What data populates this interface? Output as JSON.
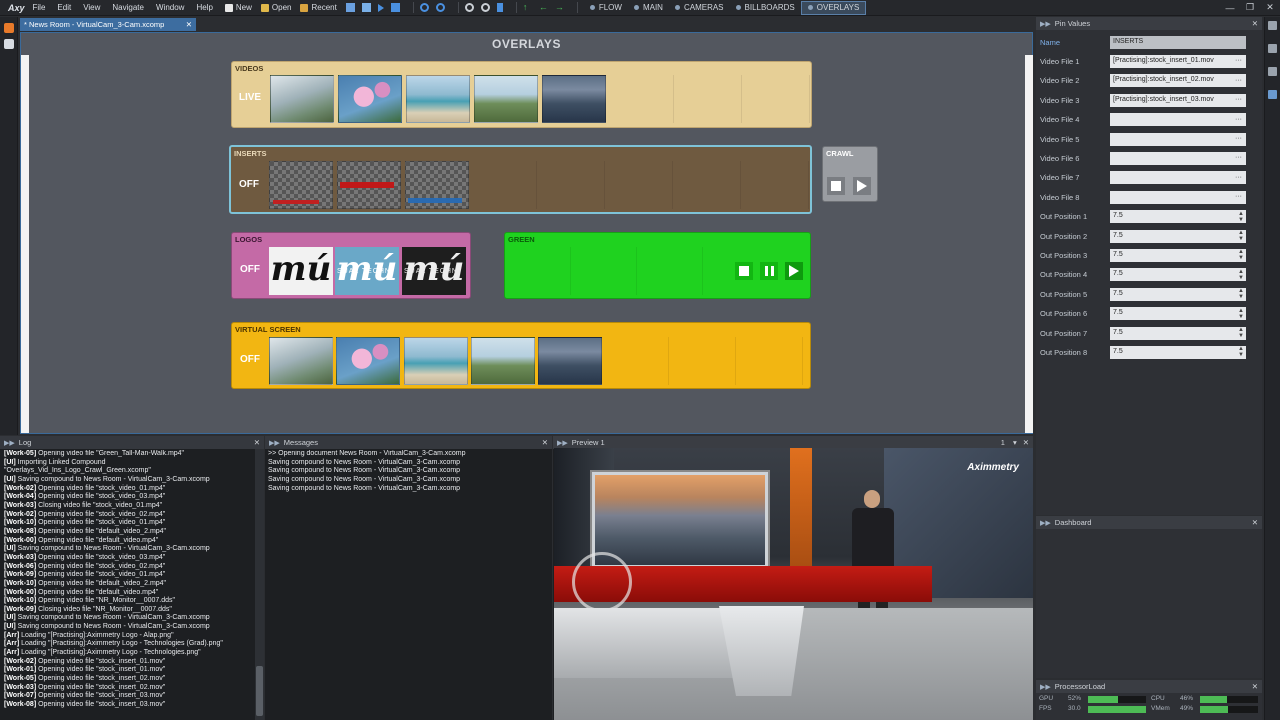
{
  "app": {
    "logo": "Axy"
  },
  "menu": [
    "File",
    "Edit",
    "View",
    "Navigate",
    "Window",
    "Help"
  ],
  "toolbar": {
    "new": "New",
    "open": "Open",
    "recent": "Recent"
  },
  "nav_tabs": [
    {
      "label": "FLOW",
      "active": false
    },
    {
      "label": "MAIN",
      "active": false
    },
    {
      "label": "CAMERAS",
      "active": false
    },
    {
      "label": "BILLBOARDS",
      "active": false
    },
    {
      "label": "OVERLAYS",
      "active": true
    }
  ],
  "document_tab": "* News Room - VirtualCam_3-Cam.xcomp",
  "overlays": {
    "title": "OVERLAYS",
    "videos": {
      "label": "VIDEOS",
      "state": "LIVE"
    },
    "inserts": {
      "label": "INSERTS",
      "state": "OFF"
    },
    "crawl": {
      "label": "CRAWL"
    },
    "logos": {
      "label": "LOGOS",
      "state": "OFF",
      "logo_text": "mú",
      "logo_sub": "SUAL TECHN"
    },
    "green": {
      "label": "GREEN"
    },
    "virtual_screen": {
      "label": "VIRTUAL SCREEN",
      "state": "OFF"
    }
  },
  "pin_values": {
    "title": "Pin Values",
    "rows": [
      {
        "label": "Name",
        "value": "INSERTS",
        "kind": "text"
      },
      {
        "label": "Video File 1",
        "value": "[Practising]:stock_insert_01.mov",
        "kind": "file"
      },
      {
        "label": "Video File 2",
        "value": "[Practising]:stock_insert_02.mov",
        "kind": "file"
      },
      {
        "label": "Video File 3",
        "value": "[Practising]:stock_insert_03.mov",
        "kind": "file"
      },
      {
        "label": "Video File 4",
        "value": "",
        "kind": "file"
      },
      {
        "label": "Video File 5",
        "value": "",
        "kind": "file"
      },
      {
        "label": "Video File 6",
        "value": "",
        "kind": "file"
      },
      {
        "label": "Video File 7",
        "value": "",
        "kind": "file"
      },
      {
        "label": "Video File 8",
        "value": "",
        "kind": "file"
      },
      {
        "label": "Out Position 1",
        "value": "7.5",
        "kind": "num"
      },
      {
        "label": "Out Position 2",
        "value": "7.5",
        "kind": "num"
      },
      {
        "label": "Out Position 3",
        "value": "7.5",
        "kind": "num"
      },
      {
        "label": "Out Position 4",
        "value": "7.5",
        "kind": "num"
      },
      {
        "label": "Out Position 5",
        "value": "7.5",
        "kind": "num"
      },
      {
        "label": "Out Position 6",
        "value": "7.5",
        "kind": "num"
      },
      {
        "label": "Out Position 7",
        "value": "7.5",
        "kind": "num"
      },
      {
        "label": "Out Position 8",
        "value": "7.5",
        "kind": "num"
      }
    ]
  },
  "dashboard": {
    "title": "Dashboard"
  },
  "processor_load": {
    "title": "ProcessorLoad",
    "gpu_label": "GPU",
    "gpu_value": "52%",
    "gpu_fraction": 0.52,
    "cpu_label": "CPU",
    "cpu_value": "46%",
    "cpu_fraction": 0.46,
    "fps_label": "FPS",
    "fps_value": "30.0",
    "fps_fraction": 1.0,
    "vmem_label": "VMem",
    "vmem_value": "49%",
    "vmem_fraction": 0.49
  },
  "log": {
    "title": "Log",
    "lines": [
      [
        "[Work-05]",
        " Opening video file \"Green_Tall-Man-Walk.mp4\""
      ],
      [
        "[UI]",
        " Importing Linked Compound"
      ],
      [
        "",
        "\"Overlays_Vid_Ins_Logo_Crawl_Green.xcomp\""
      ],
      [
        "[UI]",
        " Saving compound to News Room - VirtualCam_3-Cam.xcomp"
      ],
      [
        "[Work-02]",
        " Opening video file \"stock_video_01.mp4\""
      ],
      [
        "[Work-04]",
        " Opening video file \"stock_video_03.mp4\""
      ],
      [
        "[Work-03]",
        " Closing video file \"stock_video_01.mp4\""
      ],
      [
        "[Work-02]",
        " Opening video file \"stock_video_02.mp4\""
      ],
      [
        "[Work-10]",
        " Opening video file \"stock_video_01.mp4\""
      ],
      [
        "[Work-08]",
        " Opening video file \"default_video_2.mp4\""
      ],
      [
        "[Work-00]",
        " Opening video file \"default_video.mp4\""
      ],
      [
        "[UI]",
        " Saving compound to News Room - VirtualCam_3-Cam.xcomp"
      ],
      [
        "[Work-03]",
        " Opening video file \"stock_video_03.mp4\""
      ],
      [
        "[Work-06]",
        " Opening video file \"stock_video_02.mp4\""
      ],
      [
        "[Work-09]",
        " Opening video file \"stock_video_01.mp4\""
      ],
      [
        "[Work-10]",
        " Opening video file \"default_video_2.mp4\""
      ],
      [
        "[Work-00]",
        " Opening video file \"default_video.mp4\""
      ],
      [
        "[Work-10]",
        " Opening video file \"NR_Monitor__0007.dds\""
      ],
      [
        "[Work-09]",
        " Closing video file \"NR_Monitor__0007.dds\""
      ],
      [
        "[UI]",
        " Saving compound to News Room - VirtualCam_3-Cam.xcomp"
      ],
      [
        "[UI]",
        " Saving compound to News Room - VirtualCam_3-Cam.xcomp"
      ],
      [
        "[Arr]",
        " Loading \"[Practising]:Aximmetry Logo - Alap.png\""
      ],
      [
        "[Arr]",
        " Loading \"[Practising]:Aximmetry Logo - Technologies (Grad).png\""
      ],
      [
        "[Arr]",
        " Loading \"[Practising]:Aximmetry Logo - Technologies.png\""
      ],
      [
        "[Work-02]",
        " Opening video file \"stock_insert_01.mov\""
      ],
      [
        "[Work-01]",
        " Opening video file \"stock_insert_01.mov\""
      ],
      [
        "[Work-05]",
        " Opening video file \"stock_insert_02.mov\""
      ],
      [
        "[Work-03]",
        " Opening video file \"stock_insert_02.mov\""
      ],
      [
        "[Work-07]",
        " Opening video file \"stock_insert_03.mov\""
      ],
      [
        "[Work-08]",
        " Opening video file \"stock_insert_03.mov\""
      ]
    ]
  },
  "messages": {
    "title": "Messages",
    "lines": [
      ">> Opening document News Room - VirtualCam_3-Cam.xcomp",
      "Saving compound to News Room - VirtualCam_3-Cam.xcomp",
      "Saving compound to News Room - VirtualCam_3-Cam.xcomp",
      "Saving compound to News Room - VirtualCam_3-Cam.xcomp",
      "Saving compound to News Room - VirtualCam_3-Cam.xcomp"
    ]
  },
  "preview": {
    "title": "Preview 1",
    "index": "1",
    "brand": "Aximmetry"
  },
  "colors": {
    "videos_bg": "#e6cf96",
    "inserts_bg": "#6f5a40",
    "logos_bg": "#c46aa6",
    "green_bg": "#1fd21f",
    "virtual_bg": "#f2b612",
    "accent": "#3d6da0"
  }
}
